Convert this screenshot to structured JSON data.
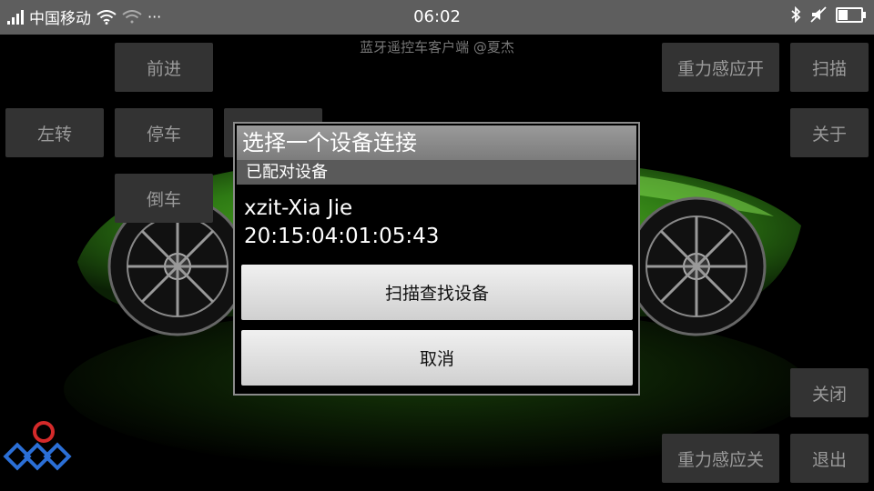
{
  "status_bar": {
    "carrier": "中国移动",
    "more_dots": "···",
    "time": "06:02"
  },
  "app": {
    "title": "蓝牙遥控车客户端 @夏杰",
    "buttons": {
      "forward": "前进",
      "left": "左转",
      "stop": "停车",
      "reverse": "倒车",
      "gravity_on": "重力感应开",
      "scan": "扫描",
      "about": "关于",
      "close": "关闭",
      "gravity_off": "重力感应关",
      "exit": "退出"
    }
  },
  "dialog": {
    "title": "选择一个设备连接",
    "section": "已配对设备",
    "device_name": "xzit-Xia Jie",
    "device_address": "20:15:04:01:05:43",
    "scan_button": "扫描查找设备",
    "cancel_button": "取消"
  },
  "colors": {
    "status_bar_bg": "#5e5e5e",
    "control_button_bg": "#333333",
    "control_button_text": "#9a9a9a",
    "car_green": "#3f8f1f"
  }
}
